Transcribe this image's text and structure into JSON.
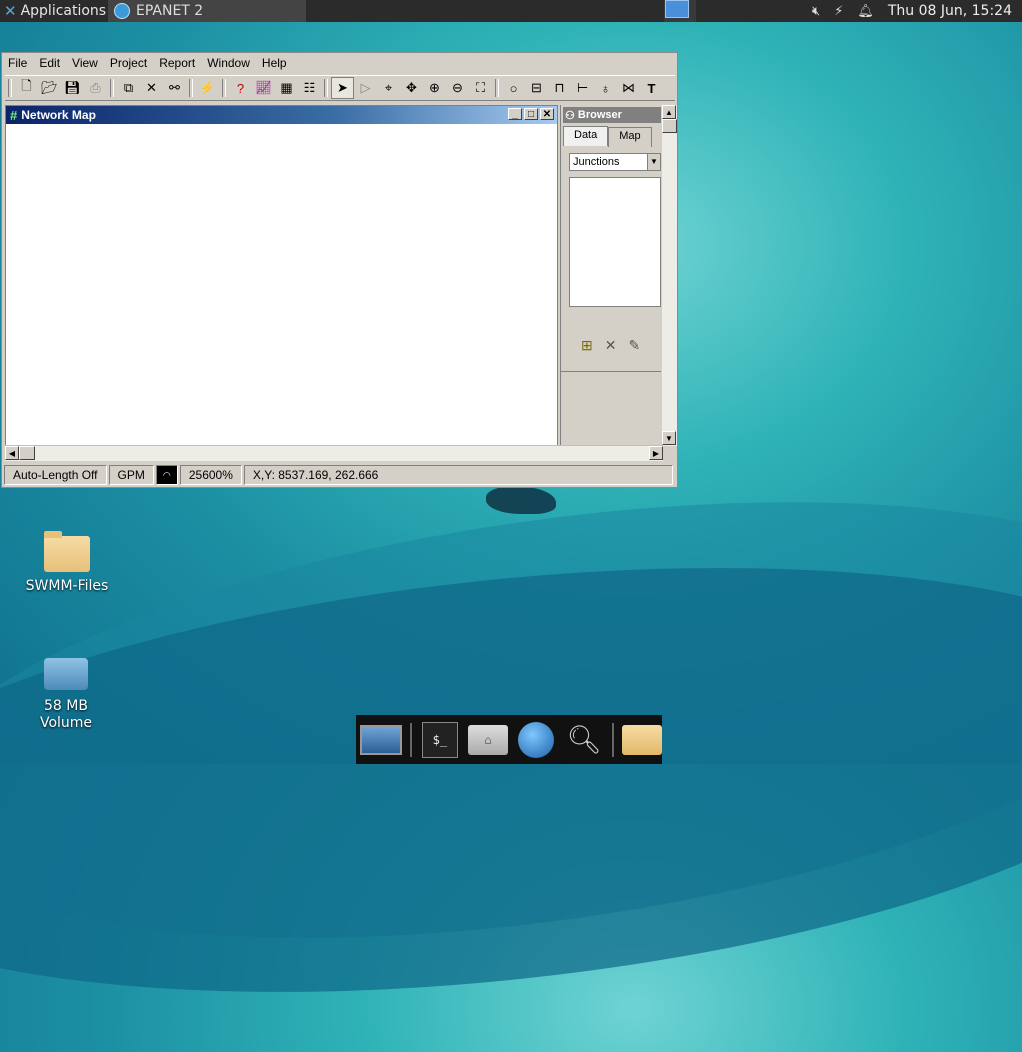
{
  "top_panel": {
    "applications_label": "Applications",
    "task_title": "EPANET 2",
    "clock": "Thu 08 Jun, 15:24"
  },
  "epanet": {
    "menu": [
      {
        "label": "File"
      },
      {
        "label": "Edit"
      },
      {
        "label": "View"
      },
      {
        "label": "Project"
      },
      {
        "label": "Report"
      },
      {
        "label": "Window"
      },
      {
        "label": "Help"
      }
    ],
    "toolbar_icons": [
      "new-icon",
      "open-icon",
      "save-icon",
      "print-icon",
      "copy-icon",
      "delete-icon",
      "find-icon",
      "run-icon",
      "query-icon",
      "graph-icon",
      "table-icon",
      "options-icon",
      "select-object-icon",
      "select-vertex-icon",
      "select-region-icon",
      "pan-icon",
      "zoom-in-icon",
      "zoom-out-icon",
      "full-extent-icon",
      "junction-icon",
      "reservoir-icon",
      "tank-icon",
      "pipe-icon",
      "pump-icon",
      "valve-icon",
      "label-icon"
    ],
    "network_map": {
      "title": "Network Map"
    },
    "browser": {
      "title": "Browser",
      "tabs": [
        "Data",
        "Map"
      ],
      "active_tab": "Data",
      "category_selected": "Junctions"
    },
    "status": {
      "auto_length": "Auto-Length Off",
      "flow_units": "GPM",
      "zoom": "25600%",
      "coords": "X,Y: 8537.169, 262.666"
    }
  },
  "desktop": {
    "icons": [
      {
        "label": "SWMM-Files"
      },
      {
        "label": "58 MB\nVolume"
      }
    ]
  },
  "dock": {
    "items": [
      "show-desktop",
      "terminal",
      "home-folder",
      "web-browser",
      "search",
      "files"
    ]
  },
  "colors": {
    "title_active_start": "#0a246a",
    "title_active_end": "#a6caf0",
    "panel_bg": "#2b2b2b",
    "win_face": "#d4d0c8"
  }
}
